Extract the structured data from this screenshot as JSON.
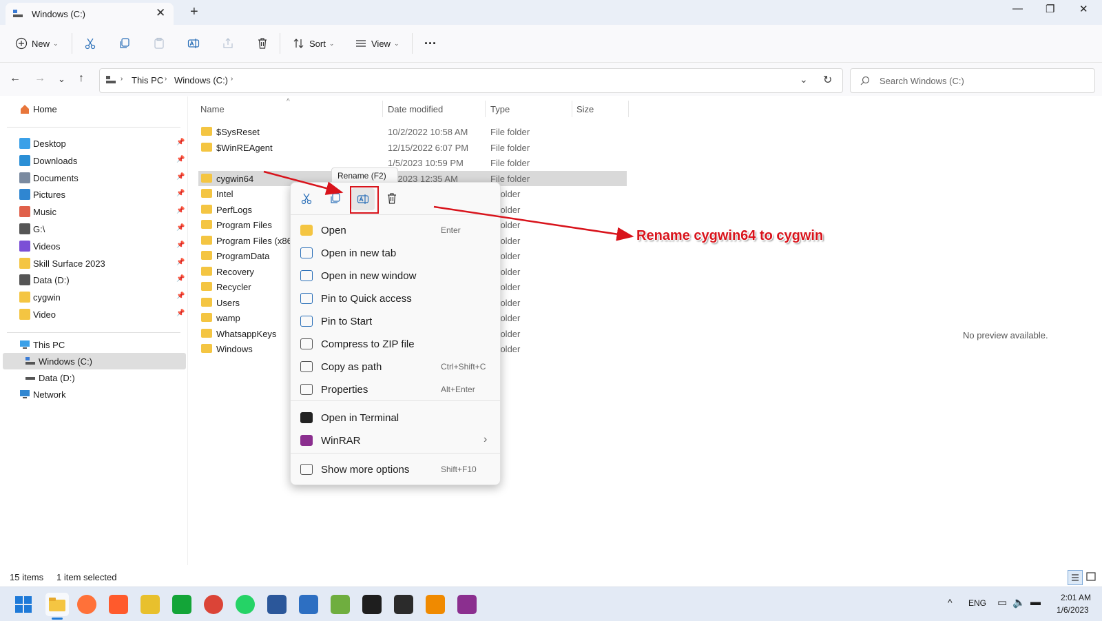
{
  "window": {
    "tab_title": "Windows (C:)",
    "new_tab_symbol": "+",
    "close_tab_symbol": "✕",
    "controls": {
      "minimize": "—",
      "maximize": "❐",
      "close": "✕"
    }
  },
  "toolbar": {
    "new_label": "New",
    "sort_label": "Sort",
    "view_label": "View",
    "more_label": "···"
  },
  "address": {
    "breadcrumb": [
      "This PC",
      "Windows (C:)"
    ],
    "search_placeholder": "Search Windows (C:)"
  },
  "nav": {
    "home": "Home",
    "quick": [
      {
        "label": "Desktop",
        "icon": "desktop-icon",
        "color": "#3aa0e8"
      },
      {
        "label": "Downloads",
        "icon": "download-icon",
        "color": "#2b8fd6"
      },
      {
        "label": "Documents",
        "icon": "documents-icon",
        "color": "#7a8aa0"
      },
      {
        "label": "Pictures",
        "icon": "pictures-icon",
        "color": "#2f86d1"
      },
      {
        "label": "Music",
        "icon": "music-icon",
        "color": "#e0604a"
      },
      {
        "label": "G:\\",
        "icon": "drive-icon",
        "color": "#555555"
      },
      {
        "label": "Videos",
        "icon": "videos-icon",
        "color": "#7b4fd6"
      },
      {
        "label": "Skill Surface 2023",
        "icon": "folder-icon",
        "color": "#f4c542"
      },
      {
        "label": "Data (D:)",
        "icon": "drive-icon",
        "color": "#555555"
      },
      {
        "label": "cygwin",
        "icon": "folder-icon",
        "color": "#f4c542"
      },
      {
        "label": "Video",
        "icon": "folder-icon",
        "color": "#f4c542"
      }
    ],
    "this_pc": "This PC",
    "drives": [
      "Windows (C:)",
      "Data (D:)"
    ],
    "network": "Network"
  },
  "columns": {
    "name": "Name",
    "date": "Date modified",
    "type": "Type",
    "size": "Size"
  },
  "files": [
    {
      "name": "$SysReset",
      "date": "10/2/2022 10:58 AM",
      "type": "File folder"
    },
    {
      "name": "$WinREAgent",
      "date": "12/15/2022 6:07 PM",
      "type": "File folder"
    },
    {
      "name": "",
      "date": "1/5/2023 10:59 PM",
      "type": "File folder"
    },
    {
      "name": "cygwin64",
      "date": "/6/2023 12:35 AM",
      "type": "File folder"
    },
    {
      "name": "Intel",
      "date": "",
      "type": "e folder"
    },
    {
      "name": "PerfLogs",
      "date": "",
      "type": "e folder"
    },
    {
      "name": "Program Files",
      "date": "",
      "type": "e folder"
    },
    {
      "name": "Program Files (x86)",
      "date": "",
      "type": "e folder"
    },
    {
      "name": "ProgramData",
      "date": "",
      "type": "e folder"
    },
    {
      "name": "Recovery",
      "date": "",
      "type": "e folder"
    },
    {
      "name": "Recycler",
      "date": "",
      "type": "e folder"
    },
    {
      "name": "Users",
      "date": "",
      "type": "e folder"
    },
    {
      "name": "wamp",
      "date": "",
      "type": "e folder"
    },
    {
      "name": "WhatsappKeys",
      "date": "",
      "type": "e folder"
    },
    {
      "name": "Windows",
      "date": "",
      "type": "e folder"
    }
  ],
  "tooltip": "Rename (F2)",
  "context_menu": {
    "items": [
      {
        "label": "Open",
        "shortcut": "Enter",
        "icon": "folder-open-icon"
      },
      {
        "label": "Open in new tab",
        "shortcut": "",
        "icon": "new-tab-icon"
      },
      {
        "label": "Open in new window",
        "shortcut": "",
        "icon": "new-window-icon"
      },
      {
        "label": "Pin to Quick access",
        "shortcut": "",
        "icon": "pin-icon"
      },
      {
        "label": "Pin to Start",
        "shortcut": "",
        "icon": "pin-icon"
      },
      {
        "label": "Compress to ZIP file",
        "shortcut": "",
        "icon": "zip-icon"
      },
      {
        "label": "Copy as path",
        "shortcut": "Ctrl+Shift+C",
        "icon": "copy-path-icon"
      },
      {
        "label": "Properties",
        "shortcut": "Alt+Enter",
        "icon": "wrench-icon"
      },
      {
        "label": "Open in Terminal",
        "shortcut": "",
        "icon": "terminal-icon"
      },
      {
        "label": "WinRAR",
        "shortcut": "›",
        "icon": "winrar-icon"
      },
      {
        "label": "Show more options",
        "shortcut": "Shift+F10",
        "icon": "more-options-icon"
      }
    ]
  },
  "annotation": {
    "text": "Rename cygwin64 to cygwin",
    "color": "#d8131b"
  },
  "preview": "No preview available.",
  "status": {
    "count": "15 items",
    "selection": "1 item selected"
  },
  "tray": {
    "lang": "ENG",
    "time": "2:01 AM",
    "date": "1/6/2023"
  }
}
